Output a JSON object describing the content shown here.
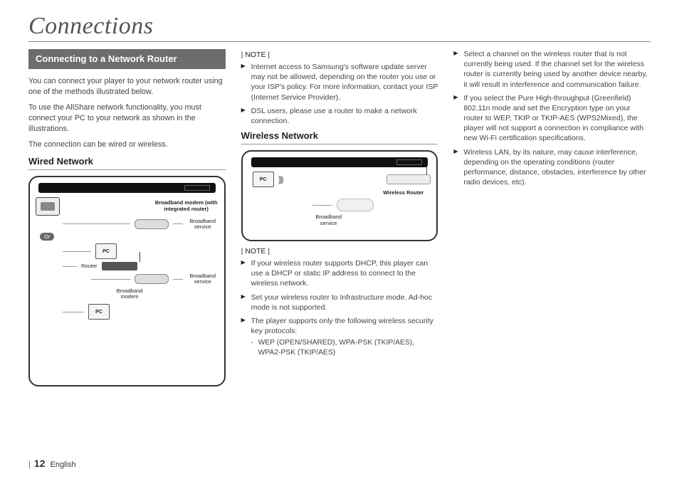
{
  "page": {
    "title": "Connections",
    "number": "12",
    "language": "English"
  },
  "section": {
    "heading": "Connecting to a Network Router",
    "intro1": "You can connect your player to your network router using one of the methods illustrated below.",
    "intro2": "To use the AllShare network functionality, you must connect your PC to your network as shown in the illustrations.",
    "intro3": "The connection can be wired or wireless."
  },
  "wired": {
    "heading": "Wired Network",
    "labels": {
      "integrated_modem": "Broadband modem\n(with integrated router)",
      "broadband_service": "Broadband service",
      "or": "Or",
      "router": "Router",
      "broadband_modem": "Broadband modem",
      "pc": "PC"
    }
  },
  "wireless": {
    "heading": "Wireless Network",
    "labels": {
      "wireless_router": "Wireless Router",
      "broadband_service": "Broadband service",
      "pc": "PC"
    }
  },
  "notes": {
    "label": "NOTE",
    "top": [
      "Internet access to Samsung's software update server may not be allowed, depending on the router you use or your ISP's policy. For more information, contact your ISP (Internet Service Provider).",
      "DSL users, please use a router to make a network connection."
    ],
    "wireless": [
      "If your wireless router supports DHCP, this player can use a DHCP or static IP address to connect to the wireless network.",
      "Set your wireless router to Infrastructure mode. Ad-hoc mode is not supported.",
      "The player supports only the following wireless security key protocols:"
    ],
    "wireless_sub": [
      "WEP (OPEN/SHARED), WPA-PSK (TKIP/AES), WPA2-PSK (TKIP/AES)"
    ],
    "right": [
      "Select a channel on the wireless router that is not currently being used. If the channel set for the wireless router is currently being used by another device nearby, it will result in interference and communication failure.",
      "If you select the Pure High-throughput (Greenfield) 802.11n mode and set the Encryption type on your router to WEP, TKIP or TKIP-AES (WPS2Mixed), the player will not support a connection in compliance with new Wi-Fi certification specifications.",
      "Wireless LAN, by its nature, may cause interference, depending on the operating conditions (router performance, distance, obstacles, interference by other radio devices, etc)."
    ]
  }
}
